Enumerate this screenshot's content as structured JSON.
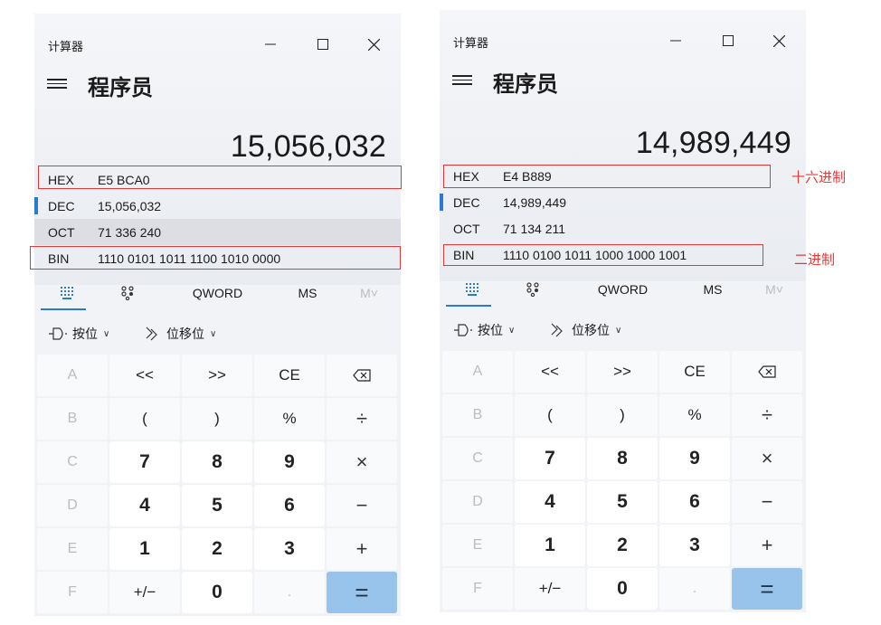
{
  "left": {
    "window_title": "计算器",
    "mode_title": "程序员",
    "display": "15,056,032",
    "radix": [
      {
        "label": "HEX",
        "value": "E5 BCA0"
      },
      {
        "label": "DEC",
        "value": "15,056,032"
      },
      {
        "label": "OCT",
        "value": "71 336 240"
      },
      {
        "label": "BIN",
        "value": "1110 0101 1011 1100 1010 0000"
      }
    ],
    "tabs": {
      "word_size": "QWORD",
      "ms": "MS",
      "mplus": "M˅"
    },
    "bitops": {
      "bitwise": "按位",
      "shift": "位移位"
    },
    "keys": [
      "A",
      "<<",
      ">>",
      "CE",
      "⌫",
      "B",
      "(",
      ")",
      "%",
      "÷",
      "C",
      "7",
      "8",
      "9",
      "×",
      "D",
      "4",
      "5",
      "6",
      "−",
      "E",
      "1",
      "2",
      "3",
      "+",
      "F",
      "+/−",
      "0",
      ".",
      "="
    ]
  },
  "right": {
    "window_title": "计算器",
    "mode_title": "程序员",
    "display": "14,989,449",
    "radix": [
      {
        "label": "HEX",
        "value": "E4 B889"
      },
      {
        "label": "DEC",
        "value": "14,989,449"
      },
      {
        "label": "OCT",
        "value": "71 134 211"
      },
      {
        "label": "BIN",
        "value": "1110 0100 1011 1000 1000 1001"
      }
    ],
    "tabs": {
      "word_size": "QWORD",
      "ms": "MS",
      "mplus": "M˅"
    },
    "bitops": {
      "bitwise": "按位",
      "shift": "位移位"
    },
    "keys": [
      "A",
      "<<",
      ">>",
      "CE",
      "⌫",
      "B",
      "(",
      ")",
      "%",
      "÷",
      "C",
      "7",
      "8",
      "9",
      "×",
      "D",
      "4",
      "5",
      "6",
      "−",
      "E",
      "1",
      "2",
      "3",
      "+",
      "F",
      "+/−",
      "0",
      ".",
      "="
    ]
  },
  "annotations": {
    "hex": "十六进制",
    "bin": "二进制"
  },
  "colors": {
    "accent": "#2b7ad2",
    "equals": "#98c3ea",
    "annotation": "#e03b3b"
  }
}
